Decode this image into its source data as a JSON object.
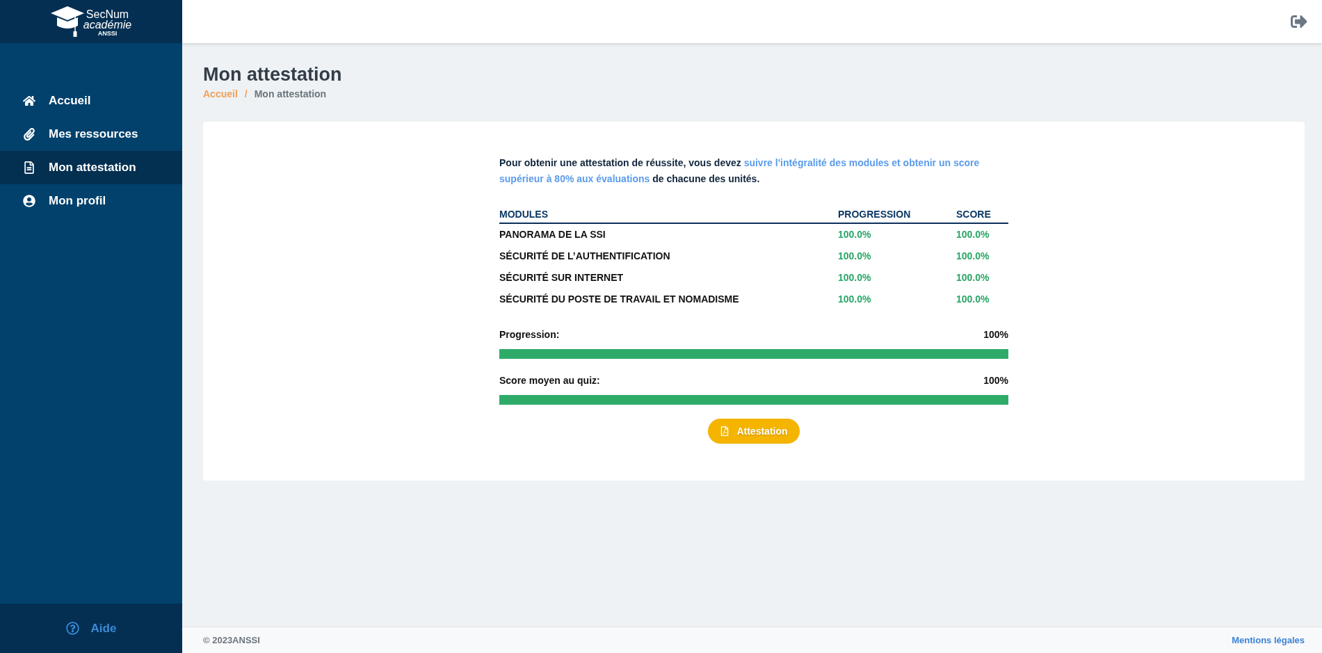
{
  "logo": {
    "title": "SecNum",
    "subtitle": "académie",
    "org": "ANSSI"
  },
  "sidebar": {
    "items": [
      {
        "label": "Accueil",
        "selected": false
      },
      {
        "label": "Mes ressources",
        "selected": false
      },
      {
        "label": "Mon attestation",
        "selected": true
      },
      {
        "label": "Mon profil",
        "selected": false
      }
    ],
    "help": "Aide"
  },
  "page": {
    "title": "Mon attestation",
    "breadcrumb": {
      "items": [
        {
          "label": "Accueil",
          "kind": "link"
        },
        {
          "label": "Mon attestation",
          "kind": "current"
        }
      ],
      "separator": "/"
    }
  },
  "card": {
    "intro": [
      {
        "text": "Pour obtenir une attestation de réussite, vous devez ",
        "kind": "plain"
      },
      {
        "text": "suivre l'intégralité des modules et obtenir un score supérieur à 80% aux évaluations",
        "kind": "highlight"
      },
      {
        "text": " de chacune des unités.",
        "kind": "plain"
      }
    ],
    "table": {
      "columns": [
        "MODULES",
        "PROGRESSION",
        "SCORE"
      ],
      "rows": [
        {
          "module": "PANORAMA DE LA SSI",
          "progression": "100.0%",
          "score": "100.0%"
        },
        {
          "module": "SÉCURITÉ DE L’AUTHENTIFICATION",
          "progression": "100.0%",
          "score": "100.0%"
        },
        {
          "module": "SÉCURITÉ SUR INTERNET",
          "progression": "100.0%",
          "score": "100.0%"
        },
        {
          "module": "SÉCURITÉ DU POSTE DE TRAVAIL ET NOMADISME",
          "progression": "100.0%",
          "score": "100.0%"
        }
      ]
    },
    "summary": [
      {
        "label": "Progression:",
        "value": "100%",
        "level": 1
      },
      {
        "label": "Score moyen au quiz:",
        "value": "100%",
        "level": 1
      }
    ],
    "button": "Attestation"
  },
  "footer": {
    "copyright": "© 2023ANSSI",
    "link": "Mentions légales"
  }
}
